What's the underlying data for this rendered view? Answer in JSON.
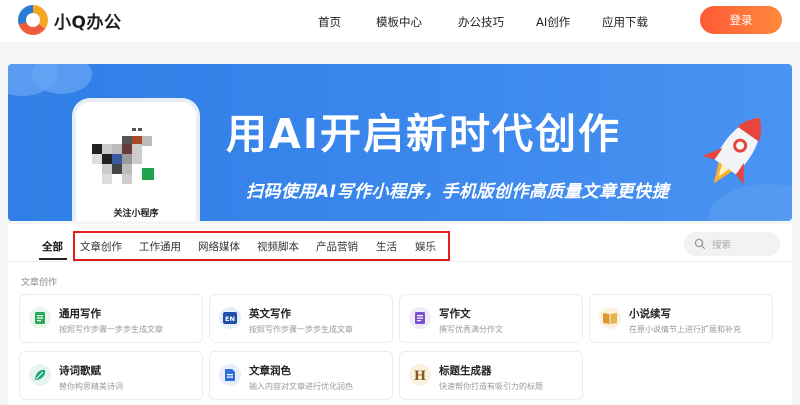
{
  "header": {
    "logo_text": "小Q办公",
    "nav": [
      "首页",
      "模板中心",
      "办公技巧",
      "AI创作",
      "应用下载"
    ],
    "login_label": "登录"
  },
  "banner": {
    "title": "用AI开启新时代创作",
    "subtitle": "扫码使用AI写作小程序，手机版创作高质量文章更快捷",
    "qr_caption": "关注小程序"
  },
  "tabs": {
    "all": "全部",
    "items": [
      "文章创作",
      "工作通用",
      "网络媒体",
      "视频脚本",
      "产品营销",
      "生活",
      "娱乐"
    ]
  },
  "search": {
    "placeholder": "搜索"
  },
  "section": {
    "label": "文章创作",
    "cards": [
      {
        "title": "通用写作",
        "desc": "按照写作步骤一步步生成文章",
        "icon": "document-green-icon",
        "color": "#e9f6ee"
      },
      {
        "title": "英文写作",
        "desc": "按照写作步骤一步步生成文章",
        "icon": "en-book-icon",
        "color": "#e8eef9"
      },
      {
        "title": "写作文",
        "desc": "撰写优秀满分作文",
        "icon": "essay-purple-icon",
        "color": "#efe9f8"
      },
      {
        "title": "小说续写",
        "desc": "在原小说情节上进行扩展和补充",
        "icon": "open-book-icon",
        "color": "#fbf1e1"
      },
      {
        "title": "诗词歌赋",
        "desc": "替你构思精美诗词",
        "icon": "leaf-icon",
        "color": "#e6f5ef"
      },
      {
        "title": "文章润色",
        "desc": "输入内容对文章进行优化润色",
        "icon": "document-blue-icon",
        "color": "#e8eef9"
      },
      {
        "title": "标题生成器",
        "desc": "快速帮你打造有吸引力的标题",
        "icon": "h-letter-icon",
        "color": "#fbf1e1"
      }
    ]
  }
}
